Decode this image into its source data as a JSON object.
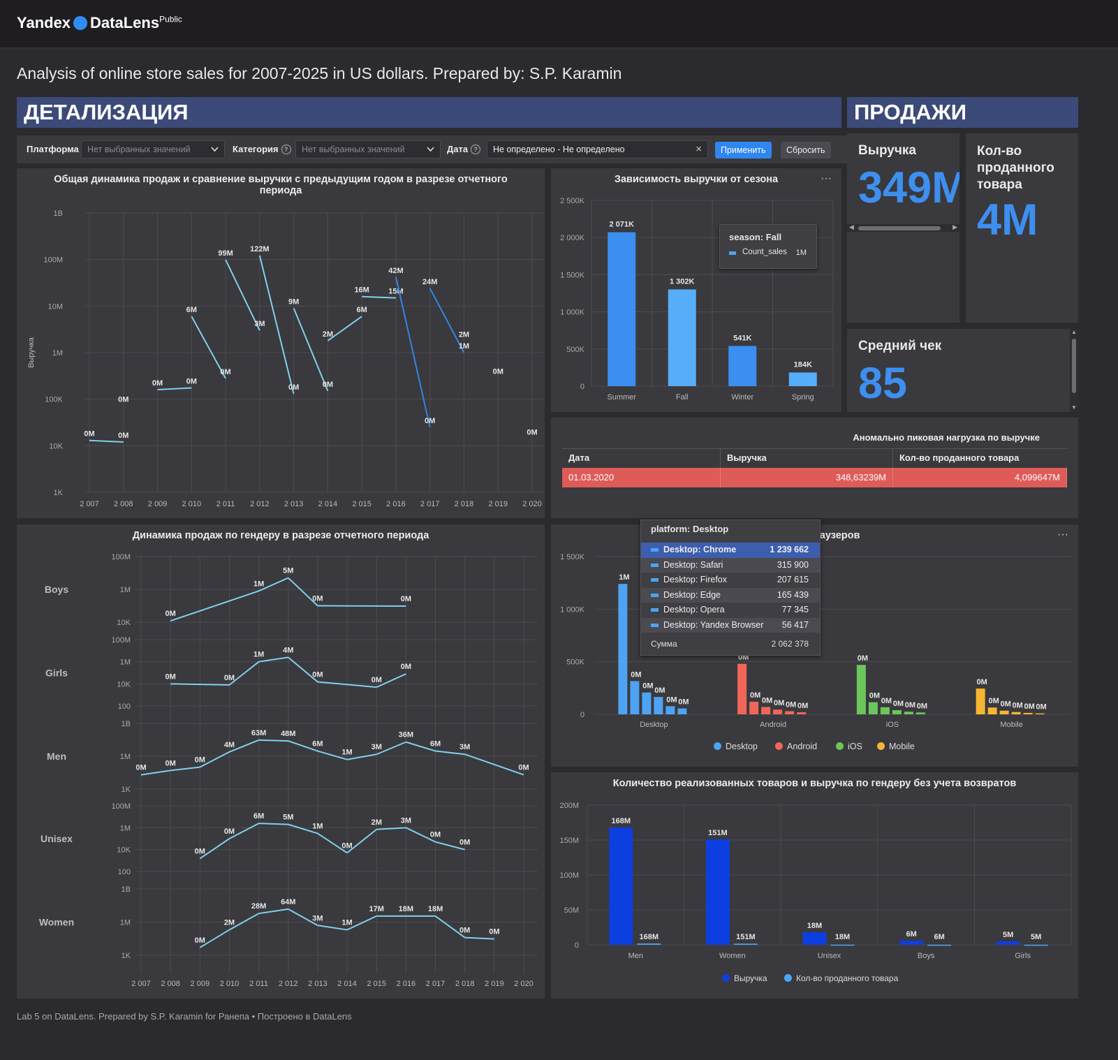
{
  "header": {
    "logo_yandex": "Yandex",
    "logo_datalens": "DataLens",
    "logo_public": "Public"
  },
  "page_title": "Analysis of online store sales for 2007-2025 in US dollars. Prepared by: S.P. Karamin",
  "sections": {
    "detail": "ДЕТАЛИЗАЦИЯ",
    "sales": "ПРОДАЖИ"
  },
  "filters": {
    "platform_label": "Платформа",
    "platform_value": "Нет выбранных значений",
    "category_label": "Категория",
    "category_value": "Нет выбранных значений",
    "date_label": "Дата",
    "date_value": "Не определено - Не определено",
    "apply": "Применить",
    "reset": "Сбросить"
  },
  "kpis": {
    "revenue_title": "Выручка",
    "revenue_value": "349M",
    "qty_title": "Кол-во проданного товара",
    "qty_value": "4M",
    "avg_title": "Средний чек",
    "avg_value": "85"
  },
  "colors": {
    "accent": "#3d8ff0",
    "line": "#7fd0ec",
    "line_dark": "#2f86e8",
    "desktop": "#4ea3f2",
    "android": "#f2665a",
    "ios": "#6cc65c",
    "mobile": "#f5b632",
    "revenue": "#0d3ee0",
    "qty": "#4aa7f5",
    "anomaly": "#de5b58"
  },
  "chart_data": [
    {
      "id": "main",
      "type": "line",
      "title": "Общая динамика продаж и сравнение выручки с предыдущим годом в разрезе отчетного периода",
      "ylabel": "Выручка",
      "yscale": "log",
      "ylim": [
        "1K",
        "1B"
      ],
      "yticks": [
        "1B",
        "100M",
        "10M",
        "1M",
        "100K",
        "10K",
        "1K"
      ],
      "x": [
        "2 007",
        "2 008",
        "2 009",
        "2 010",
        "2 011",
        "2 012",
        "2 013",
        "2 014",
        "2 015",
        "2 016",
        "2 017",
        "2 018",
        "2 019",
        "2 020"
      ],
      "segments": [
        {
          "x": [
            "2 007",
            "2 008"
          ],
          "y": [
            13000,
            12000
          ],
          "labels": [
            "0M",
            "0M"
          ]
        },
        {
          "x": [
            "2 009",
            "2 010"
          ],
          "y": [
            160000,
            175000
          ],
          "labels": [
            "0M",
            "0M"
          ]
        },
        {
          "x": [
            "2 010",
            "2 011"
          ],
          "y": [
            6000000,
            280000
          ],
          "labels": [
            "6M",
            "0M"
          ]
        },
        {
          "x": [
            "2 011",
            "2 012"
          ],
          "y": [
            99000000,
            3000000
          ],
          "labels": [
            "99M",
            "3M"
          ]
        },
        {
          "x": [
            "2 012",
            "2 013"
          ],
          "y": [
            122000000,
            130000
          ],
          "labels": [
            "122M",
            "0M"
          ]
        },
        {
          "x": [
            "2 013",
            "2 014"
          ],
          "y": [
            9000000,
            150000
          ],
          "labels": [
            "9M",
            "0M"
          ]
        },
        {
          "x": [
            "2 014",
            "2 015"
          ],
          "y": [
            1800000,
            6000000
          ],
          "labels": [
            "2M",
            "6M"
          ]
        },
        {
          "x": [
            "2 015",
            "2 016"
          ],
          "y": [
            16000000,
            15000000
          ],
          "labels": [
            "16M",
            "15M"
          ]
        },
        {
          "x": [
            "2 016",
            "2 017"
          ],
          "y": [
            42000000,
            25000
          ],
          "labels": [
            "42M",
            "0M"
          ],
          "dark": true
        },
        {
          "x": [
            "2 017",
            "2 018"
          ],
          "y": [
            24000000,
            1000000
          ],
          "labels": [
            "24M",
            "1M"
          ],
          "dark": true
        }
      ],
      "points": [
        {
          "x": "2 008",
          "y": 100000,
          "label": "0M"
        },
        {
          "x": "2 018",
          "y": 2500000,
          "label": "2M"
        },
        {
          "x": "2 019",
          "y": 400000,
          "label": "0M"
        },
        {
          "x": "2 020",
          "y": 20000,
          "label": "0M"
        }
      ]
    },
    {
      "id": "season",
      "type": "bar",
      "title": "Зависимость выручки от сезона",
      "categories": [
        "Summer",
        "Fall",
        "Winter",
        "Spring"
      ],
      "values": [
        2071000,
        1302000,
        541000,
        184000
      ],
      "labels": [
        "2 071K",
        "1 302K",
        "541K",
        "184K"
      ],
      "ylim": [
        0,
        2500000
      ],
      "yticks": [
        "2 500K",
        "2 000K",
        "1 500K",
        "1 000K",
        "500K",
        "0"
      ],
      "tooltip": {
        "title": "season: Fall",
        "series": "Count_sales",
        "value": "1M"
      }
    },
    {
      "id": "gender_dynamics",
      "type": "line",
      "title": "Динамика продаж по гендеру в разрезе отчетного периода",
      "x": [
        "2 007",
        "2 008",
        "2 009",
        "2 010",
        "2 011",
        "2 012",
        "2 013",
        "2 014",
        "2 015",
        "2 016",
        "2 017",
        "2 018",
        "2 019",
        "2 020"
      ],
      "panels": [
        {
          "name": "Boys",
          "yticks": [
            "100M",
            "1M",
            "10K"
          ],
          "ylim": [
            10000,
            100000000
          ],
          "points": [
            {
              "x": "2 008",
              "y": 12000,
              "label": "0M"
            },
            {
              "x": "2 011",
              "y": 800000,
              "label": "1M"
            },
            {
              "x": "2 012",
              "y": 5000000,
              "label": "5M"
            },
            {
              "x": "2 013",
              "y": 100000,
              "label": "0M"
            },
            {
              "x": "2 016",
              "y": 95000,
              "label": "0M"
            }
          ]
        },
        {
          "name": "Girls",
          "yticks": [
            "100M",
            "1M",
            "10K",
            "100"
          ],
          "ylim": [
            100,
            100000000
          ],
          "points": [
            {
              "x": "2 008",
              "y": 10000,
              "label": "0M"
            },
            {
              "x": "2 010",
              "y": 8000,
              "label": "0M"
            },
            {
              "x": "2 011",
              "y": 1000000,
              "label": "1M"
            },
            {
              "x": "2 012",
              "y": 2500000,
              "label": "4M"
            },
            {
              "x": "2 013",
              "y": 15000,
              "label": "0M"
            },
            {
              "x": "2 015",
              "y": 5000,
              "label": "0M"
            },
            {
              "x": "2 016",
              "y": 80000,
              "label": "0M"
            }
          ]
        },
        {
          "name": "Men",
          "yticks": [
            "1B",
            "1M",
            "1K"
          ],
          "ylim": [
            1000,
            1000000000
          ],
          "points": [
            {
              "x": "2 007",
              "y": 20000,
              "label": "0M"
            },
            {
              "x": "2 008",
              "y": 50000,
              "label": "0M"
            },
            {
              "x": "2 009",
              "y": 100000,
              "label": "0M"
            },
            {
              "x": "2 010",
              "y": 2500000,
              "label": "4M"
            },
            {
              "x": "2 011",
              "y": 30000000,
              "label": "63M"
            },
            {
              "x": "2 012",
              "y": 25000000,
              "label": "48M"
            },
            {
              "x": "2 013",
              "y": 3000000,
              "label": "6M"
            },
            {
              "x": "2 014",
              "y": 500000,
              "label": "1M"
            },
            {
              "x": "2 015",
              "y": 1500000,
              "label": "3M"
            },
            {
              "x": "2 016",
              "y": 20000000,
              "label": "36M"
            },
            {
              "x": "2 017",
              "y": 3000000,
              "label": "6M"
            },
            {
              "x": "2 018",
              "y": 1500000,
              "label": "3M"
            },
            {
              "x": "2 020",
              "y": 20000,
              "label": "0M"
            }
          ]
        },
        {
          "name": "Unisex",
          "yticks": [
            "100M",
            "1M",
            "10K",
            "100"
          ],
          "ylim": [
            100,
            100000000
          ],
          "points": [
            {
              "x": "2 009",
              "y": 1500,
              "label": "0M"
            },
            {
              "x": "2 010",
              "y": 100000,
              "label": "0M"
            },
            {
              "x": "2 011",
              "y": 2500000,
              "label": "6M"
            },
            {
              "x": "2 012",
              "y": 2000000,
              "label": "5M"
            },
            {
              "x": "2 013",
              "y": 300000,
              "label": "1M"
            },
            {
              "x": "2 014",
              "y": 5000,
              "label": "0M"
            },
            {
              "x": "2 015",
              "y": 700000,
              "label": "2M"
            },
            {
              "x": "2 016",
              "y": 1000000,
              "label": "3M"
            },
            {
              "x": "2 017",
              "y": 50000,
              "label": "0M"
            },
            {
              "x": "2 018",
              "y": 10000,
              "label": "0M"
            }
          ]
        },
        {
          "name": "Women",
          "yticks": [
            "1B",
            "1M",
            "1K"
          ],
          "ylim": [
            1000,
            1000000000
          ],
          "points": [
            {
              "x": "2 009",
              "y": 5000,
              "label": "0M"
            },
            {
              "x": "2 010",
              "y": 200000,
              "label": "2M"
            },
            {
              "x": "2 011",
              "y": 6000000,
              "label": "28M"
            },
            {
              "x": "2 012",
              "y": 15000000,
              "label": "64M"
            },
            {
              "x": "2 013",
              "y": 500000,
              "label": "3M"
            },
            {
              "x": "2 014",
              "y": 200000,
              "label": "1M"
            },
            {
              "x": "2 015",
              "y": 3500000,
              "label": "17M"
            },
            {
              "x": "2 016",
              "y": 3500000,
              "label": "18M"
            },
            {
              "x": "2 017",
              "y": 3500000,
              "label": "18M"
            },
            {
              "x": "2 018",
              "y": 40000,
              "label": "0M"
            },
            {
              "x": "2 019",
              "y": 30000,
              "label": "0M"
            }
          ]
        }
      ]
    },
    {
      "id": "platforms",
      "type": "bar",
      "title": "... платформ и браузеров",
      "categories": [
        "Desktop",
        "Android",
        "iOS",
        "Mobile"
      ],
      "ylim": [
        0,
        1500000
      ],
      "yticks": [
        "1 500K",
        "1 000K",
        "500K",
        "0"
      ],
      "groups": [
        {
          "name": "Desktop",
          "values": [
            1239662,
            315900,
            207615,
            165439,
            77345,
            56417
          ],
          "labels": [
            "1M",
            "0M",
            "0M",
            "0M",
            "0M",
            "0M"
          ]
        },
        {
          "name": "Android",
          "values": [
            480000,
            120000,
            70000,
            45000,
            30000,
            20000
          ],
          "labels": [
            "0M",
            "0M",
            "0M",
            "0M",
            "0M",
            "0M"
          ]
        },
        {
          "name": "iOS",
          "values": [
            470000,
            115000,
            68000,
            40000,
            25000,
            18000
          ],
          "labels": [
            "0M",
            "0M",
            "0M",
            "0M",
            "0M",
            "0M"
          ]
        },
        {
          "name": "Mobile",
          "values": [
            245000,
            65000,
            35000,
            22000,
            14000,
            9000
          ],
          "labels": [
            "0M",
            "0M",
            "0M",
            "0M",
            "0M",
            "0M"
          ]
        }
      ],
      "legend": [
        "Desktop",
        "Android",
        "iOS",
        "Mobile"
      ],
      "tooltip": {
        "title": "platform: Desktop",
        "rows": [
          {
            "name": "Desktop: Chrome",
            "value": "1 239 662"
          },
          {
            "name": "Desktop: Safari",
            "value": "315 900"
          },
          {
            "name": "Desktop: Firefox",
            "value": "207 615"
          },
          {
            "name": "Desktop: Edge",
            "value": "165 439"
          },
          {
            "name": "Desktop: Opera",
            "value": "77 345"
          },
          {
            "name": "Desktop: Yandex Browser",
            "value": "56 417"
          }
        ],
        "sum_label": "Сумма",
        "sum_value": "2 062 378"
      }
    },
    {
      "id": "gender_totals",
      "type": "bar",
      "title": "Количество реализованных товаров и выручка по гендеру без учета возвратов",
      "categories": [
        "Men",
        "Women",
        "Unisex",
        "Boys",
        "Girls"
      ],
      "ylim": [
        0,
        200000000
      ],
      "yticks": [
        "200M",
        "150M",
        "100M",
        "50M",
        "0"
      ],
      "series": [
        {
          "name": "Выручка",
          "values": [
            168000000,
            151000000,
            18000000,
            6000000,
            5000000
          ],
          "labels": [
            "168M",
            "151M",
            "18M",
            "6M",
            "5M"
          ]
        },
        {
          "name": "Кол-во проданного товара",
          "values": [
            1800000,
            1600000,
            200000,
            70000,
            60000
          ],
          "labels": [
            "168M",
            "151M",
            "18M",
            "6M",
            "5M"
          ]
        }
      ]
    }
  ],
  "anomaly_table": {
    "title": "Аномально пиковая нагрузка по выручке",
    "columns": [
      "Дата",
      "Выручка",
      "Кол-во проданного товара"
    ],
    "row": [
      "01.03.2020",
      "348,63239M",
      "4,099647M"
    ]
  },
  "footer": "Lab 5 on DataLens. Prepared by S.P. Karamin for Ранепа • Построено в DataLens"
}
